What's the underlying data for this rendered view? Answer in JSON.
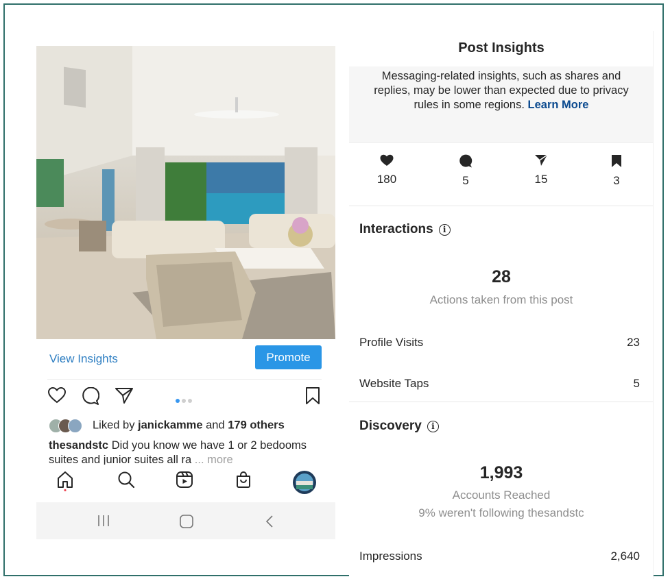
{
  "post": {
    "view_insights": "View Insights",
    "promote": "Promote",
    "liked_by_prefix": "Liked by ",
    "liked_by_user": "janickamme",
    "liked_by_mid": " and ",
    "liked_by_others": "179 others",
    "caption_user": "thesandstc",
    "caption_text": " Did you know we have 1 or 2 bedooms suites and junior suites all ra",
    "caption_more": "... more",
    "carousel": {
      "total": 3,
      "current": 1
    }
  },
  "icons": {
    "actions": [
      "heart-icon",
      "comment-icon",
      "share-icon",
      "bookmark-icon"
    ],
    "tabbar": [
      "home-icon",
      "search-icon",
      "reels-icon",
      "shop-icon",
      "profile-avatar"
    ],
    "system_nav": [
      "recents-icon",
      "home-button-icon",
      "back-icon"
    ]
  },
  "insights": {
    "title": "Post Insights",
    "notice_text": "Messaging-related insights, such as shares and replies, may be lower than expected due to privacy rules in some regions.",
    "notice_link": "Learn More",
    "stats": [
      {
        "icon": "heart-icon",
        "value": "180"
      },
      {
        "icon": "comment-icon",
        "value": "5"
      },
      {
        "icon": "share-icon",
        "value": "15"
      },
      {
        "icon": "bookmark-icon",
        "value": "3"
      }
    ],
    "interactions": {
      "heading": "Interactions",
      "total": "28",
      "total_label": "Actions taken from this post",
      "rows": [
        {
          "label": "Profile Visits",
          "value": "23"
        },
        {
          "label": "Website Taps",
          "value": "5"
        }
      ]
    },
    "discovery": {
      "heading": "Discovery",
      "total": "1,993",
      "total_label": "Accounts Reached",
      "sub_label": "9% weren't following thesandstc",
      "rows": [
        {
          "label": "Impressions",
          "value": "2,640"
        }
      ]
    }
  },
  "colors": {
    "accent": "#2a96e6",
    "link": "#0b4a8f",
    "frame": "#2f6f6a"
  }
}
